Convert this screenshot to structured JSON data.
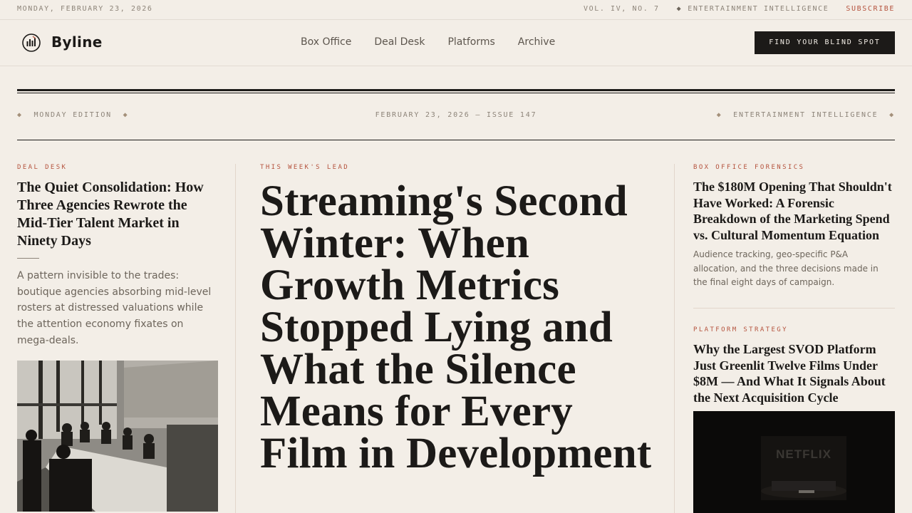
{
  "topbar": {
    "date": "MONDAY, FEBRUARY 23, 2026",
    "volume": "VOL. IV, NO. 7",
    "tagline": "ENTERTAINMENT INTELLIGENCE",
    "subscribe": "SUBSCRIBE"
  },
  "nav": {
    "brand": "Byline",
    "links": [
      "Box Office",
      "Deal Desk",
      "Platforms",
      "Archive"
    ],
    "cta": "FIND YOUR BLIND SPOT"
  },
  "masthead": {
    "edition": "MONDAY EDITION",
    "date_issue": "FEBRUARY 23, 2026 — ISSUE 147",
    "section": "ENTERTAINMENT INTELLIGENCE"
  },
  "left": {
    "kicker": "DEAL DESK",
    "headline": "The Quiet Consolidation: How Three Agencies Rewrote the Mid-Tier Talent Market in Ninety Days",
    "dek": "A pattern invisible to the trades: boutique agencies absorbing mid-level rosters at distressed valuations while the attention economy fixates on mega-deals."
  },
  "lead": {
    "kicker": "THIS WEEK'S LEAD",
    "headline": "Streaming's Second Winter: When Growth Metrics Stopped Lying and What the Silence Means for Every Film in Development"
  },
  "right": {
    "story1": {
      "kicker": "BOX OFFICE FORENSICS",
      "headline": "The $180M Opening That Shouldn't Have Worked: A Forensic Breakdown of the Marketing Spend vs. Cultural Momentum Equation",
      "dek": "Audience tracking, geo-specific P&A allocation, and the three decisions made in the final eight days of campaign."
    },
    "story2": {
      "kicker": "PLATFORM STRATEGY",
      "headline": "Why the Largest SVOD Platform Just Greenlit Twelve Films Under $8M — And What It Signals About the Next Acquisition Cycle",
      "image_text": "NETFLIX"
    }
  },
  "colors": {
    "background": "#f3eee7",
    "ink": "#1c1a18",
    "accent": "#b5533e",
    "muted": "#8d8479"
  }
}
